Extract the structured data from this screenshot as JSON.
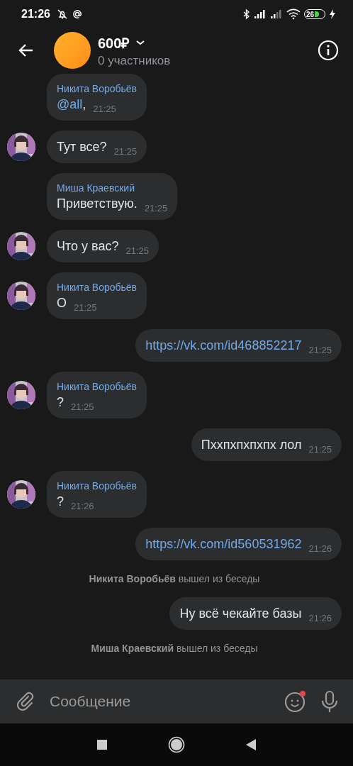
{
  "status_bar": {
    "time": "21:26",
    "battery": "26"
  },
  "header": {
    "title": "600₽",
    "subtitle": "0 участников"
  },
  "messages": [
    {
      "kind": "incoming",
      "avatar": false,
      "sender": "Никита Воробьёв",
      "mention": "@all",
      "text": ",",
      "time": "21:25",
      "link": false
    },
    {
      "kind": "incoming",
      "avatar": true,
      "text": "Тут все?",
      "time": "21:25",
      "link": false
    },
    {
      "kind": "incoming",
      "avatar": false,
      "sender": "Миша Краевский",
      "text": "Приветствую.",
      "time": "21:25",
      "link": false
    },
    {
      "kind": "incoming",
      "avatar": true,
      "text": "Что у вас?",
      "time": "21:25",
      "link": false
    },
    {
      "kind": "incoming",
      "avatar": true,
      "sender": "Никита Воробьёв",
      "text": "О",
      "time": "21:25",
      "link": false
    },
    {
      "kind": "outgoing",
      "text": "https://vk.com/id468852217",
      "time": "21:25",
      "link": true
    },
    {
      "kind": "incoming",
      "avatar": true,
      "sender": "Никита Воробьёв",
      "text": "?",
      "time": "21:25",
      "link": false
    },
    {
      "kind": "outgoing",
      "text": "Пххпхпхпхпх лол",
      "time": "21:25",
      "link": false
    },
    {
      "kind": "incoming",
      "avatar": true,
      "sender": "Никита Воробьёв",
      "text": "?",
      "time": "21:26",
      "link": false
    },
    {
      "kind": "outgoing",
      "text": "https://vk.com/id560531962",
      "time": "21:26",
      "link": true
    },
    {
      "kind": "system",
      "text": "**Никита Воробьёв** вышел из беседы"
    },
    {
      "kind": "outgoing",
      "text": "Ну всё чекайте базы",
      "time": "21:26",
      "link": false
    },
    {
      "kind": "system",
      "text": "**Миша Краевский** вышел из беседы"
    }
  ],
  "composer": {
    "placeholder": "Сообщение",
    "emoji_badge": true
  }
}
